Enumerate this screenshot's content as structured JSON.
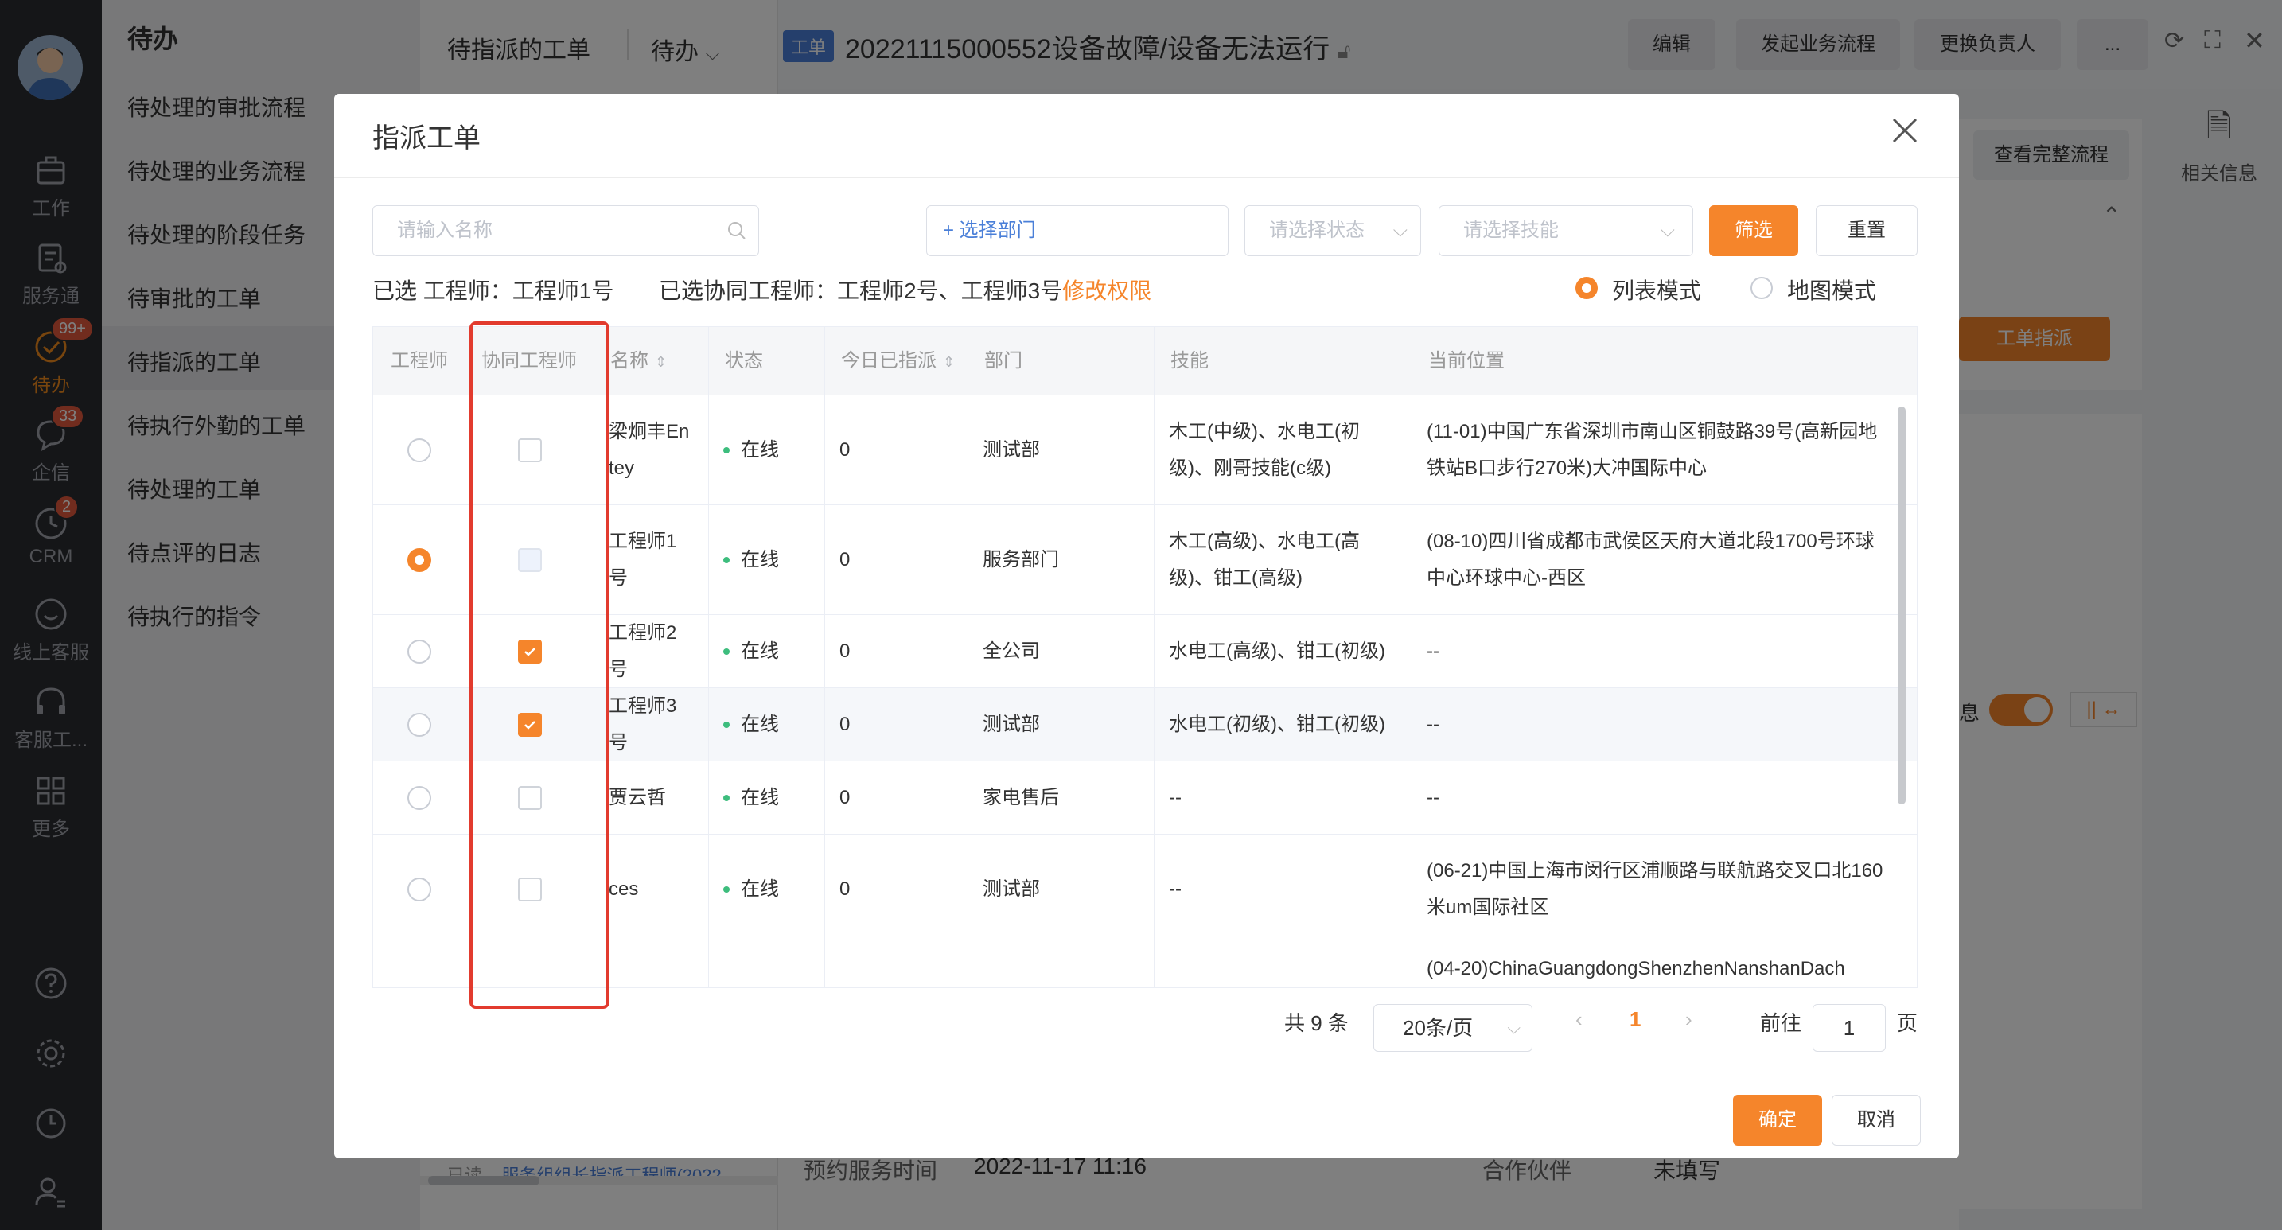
{
  "rail": {
    "items": [
      {
        "label": "工作",
        "icon": "briefcase-icon"
      },
      {
        "label": "服务通",
        "icon": "clipboard-icon"
      },
      {
        "label": "待办",
        "icon": "todo-check-icon",
        "badge": "99+"
      },
      {
        "label": "企信",
        "icon": "chat-bubble-icon",
        "badge": "33"
      },
      {
        "label": "CRM",
        "icon": "clock-icon",
        "badge": "2"
      },
      {
        "label": "线上客服",
        "icon": "smile-icon"
      },
      {
        "label": "客服工...",
        "icon": "headset-icon"
      },
      {
        "label": "更多",
        "icon": "grid-icon"
      }
    ],
    "bottom_icons": [
      "help-icon",
      "settings-icon",
      "history-icon",
      "user-settings-icon"
    ]
  },
  "nav2": {
    "title": "待办",
    "items": [
      "待处理的审批流程",
      "待处理的业务流程",
      "待处理的阶段任务",
      "待审批的工单",
      "待指派的工单",
      "待执行外勤的工单",
      "待处理的工单",
      "待点评的日志",
      "待执行的指令"
    ]
  },
  "list": {
    "heading": "待指派的工单",
    "filter": "待办",
    "footer_left": "已读",
    "footer_link": "服务组组长指派工程师(2022..."
  },
  "header": {
    "tag": "工单",
    "title": "20221115000552设备故障/设备无法运行",
    "buttons": [
      "编辑",
      "发起业务流程",
      "更换负责人",
      "..."
    ],
    "right_panel": "相关信息",
    "view_flow": "查看完整流程",
    "assign": "工单指派",
    "info_label": "息"
  },
  "bg_details": {
    "appoint_label": "预约服务时间",
    "appoint_value": "2022-11-17 11:16",
    "partner_label": "合作伙伴",
    "partner_value": "未填写"
  },
  "dialog": {
    "title": "指派工单",
    "search_placeholder": "请输入名称",
    "dept_button": "+ 选择部门",
    "status_placeholder": "请选择状态",
    "skill_placeholder": "请选择技能",
    "filter_button": "筛选",
    "reset_button": "重置",
    "selected_engineer": "已选 工程师：工程师1号",
    "selected_co": "已选协同工程师：工程师2号、工程师3号",
    "modify_link": "修改权限",
    "mode_list": "列表模式",
    "mode_map": "地图模式",
    "columns": [
      "工程师",
      "协同工程师",
      "名称",
      "状态",
      "今日已指派",
      "部门",
      "技能",
      "当前位置"
    ],
    "rows": [
      {
        "name": "梁炯丰Entey",
        "status": "在线",
        "count": "0",
        "dept": "测试部",
        "skill": "木工(中级)、水电工(初级)、刚哥技能(c级)",
        "loc": "(11-01)中国广东省深圳市南山区铜鼓路39号(高新园地铁站B口步行270米)大冲国际中心",
        "engineer": false,
        "co": "off"
      },
      {
        "name": "工程师1号",
        "status": "在线",
        "count": "0",
        "dept": "服务部门",
        "skill": "木工(高级)、水电工(高级)、钳工(高级)",
        "loc": "(08-10)四川省成都市武侯区天府大道北段1700号环球中心环球中心-西区",
        "engineer": true,
        "co": "disabled"
      },
      {
        "name": "工程师2号",
        "status": "在线",
        "count": "0",
        "dept": "全公司",
        "skill": "水电工(高级)、钳工(初级)",
        "loc": "--",
        "engineer": false,
        "co": "on"
      },
      {
        "name": "工程师3号",
        "status": "在线",
        "count": "0",
        "dept": "测试部",
        "skill": "水电工(初级)、钳工(初级)",
        "loc": "--",
        "engineer": false,
        "co": "on"
      },
      {
        "name": "贾云哲",
        "status": "在线",
        "count": "0",
        "dept": "家电售后",
        "skill": "--",
        "loc": "--",
        "engineer": false,
        "co": "off"
      },
      {
        "name": "ces",
        "status": "在线",
        "count": "0",
        "dept": "测试部",
        "skill": "--",
        "loc": "(06-21)中国上海市闵行区浦顺路与联航路交叉口北160米um国际社区",
        "engineer": false,
        "co": "off"
      },
      {
        "name": "",
        "status": "",
        "count": "",
        "dept": "",
        "skill": "",
        "loc": "(04-20)ChinaGuangdongShenzhenNanshanDach",
        "engineer": null,
        "co": "none"
      }
    ],
    "total": "共 9 条",
    "page_size": "20条/页",
    "current_page": "1",
    "goto_label": "前往",
    "goto_value": "1",
    "page_unit": "页",
    "confirm": "确定",
    "cancel": "取消"
  },
  "colors": {
    "accent": "#f5852b",
    "online": "#3dbd7d",
    "highlight_box": "#e23b2e"
  }
}
